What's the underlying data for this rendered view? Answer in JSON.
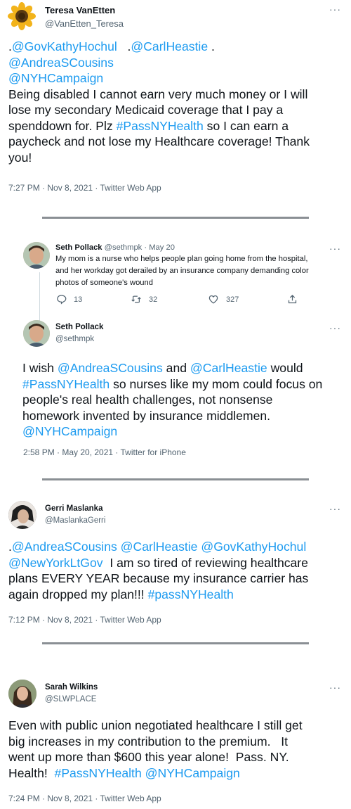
{
  "tweets": [
    {
      "name": "Teresa VanEtten",
      "handle": "@VanEtten_Teresa",
      "more": "···",
      "lines": [
        [
          {
            "t": ".",
            "l": false
          },
          {
            "t": "@GovKathyHochul",
            "l": true
          },
          {
            "t": "   .",
            "l": false
          },
          {
            "t": "@CarlHeastie",
            "l": true
          },
          {
            "t": " .",
            "l": false
          }
        ],
        [
          {
            "t": "@AndreaSCousins",
            "l": true
          }
        ],
        [
          {
            "t": "@NYHCampaign",
            "l": true
          }
        ],
        [
          {
            "t": "Being disabled I cannot earn very much money or I will",
            "l": false
          }
        ],
        [
          {
            "t": "lose my secondary Medicaid coverage that I pay a",
            "l": false
          }
        ],
        [
          {
            "t": "spenddown for. Plz ",
            "l": false
          },
          {
            "t": "#PassNYHealth",
            "l": true
          },
          {
            "t": " so I can earn a",
            "l": false
          }
        ],
        [
          {
            "t": "paycheck and not lose my Healthcare coverage! Thank",
            "l": false
          }
        ],
        [
          {
            "t": "you!",
            "l": false
          }
        ]
      ],
      "meta": "7:27 PM · Nov 8, 2021 · Twitter Web App"
    },
    {
      "quoted": {
        "name": "Seth Pollack",
        "handle": "@sethmpk",
        "date": "· May 20",
        "more": "···",
        "lines": [
          "My mom is a nurse who helps people plan going home from the hospital,",
          "and her workday got derailed by an insurance company demanding color",
          "photos of someone's wound"
        ],
        "replies": "13",
        "retweets": "32",
        "likes": "327"
      },
      "name": "Seth Pollack",
      "handle": "@sethmpk",
      "more": "···",
      "lines": [
        [
          {
            "t": "I wish ",
            "l": false
          },
          {
            "t": "@AndreaSCousins",
            "l": true
          },
          {
            "t": " and ",
            "l": false
          },
          {
            "t": "@CarlHeastie",
            "l": true
          },
          {
            "t": " would",
            "l": false
          }
        ],
        [
          {
            "t": "#PassNYHealth",
            "l": true
          },
          {
            "t": " so nurses like my mom could focus on",
            "l": false
          }
        ],
        [
          {
            "t": "people's real health challenges, not nonsense",
            "l": false
          }
        ],
        [
          {
            "t": "homework invented by insurance middlemen.",
            "l": false
          }
        ],
        [
          {
            "t": "@NYHCampaign",
            "l": true
          }
        ]
      ],
      "meta": "2:58 PM · May 20, 2021 · Twitter for iPhone"
    },
    {
      "name": "Gerri Maslanka",
      "handle": "@MaslankaGerri",
      "more": "···",
      "lines": [
        [
          {
            "t": ".",
            "l": false
          },
          {
            "t": "@AndreaSCousins",
            "l": true
          },
          {
            "t": " ",
            "l": false
          },
          {
            "t": "@CarlHeastie",
            "l": true
          },
          {
            "t": " ",
            "l": false
          },
          {
            "t": "@GovKathyHochul",
            "l": true
          }
        ],
        [
          {
            "t": "@NewYorkLtGov",
            "l": true
          },
          {
            "t": "  I am so tired of reviewing healthcare",
            "l": false
          }
        ],
        [
          {
            "t": "plans EVERY YEAR because my insurance carrier has",
            "l": false
          }
        ],
        [
          {
            "t": "again dropped my plan!!! ",
            "l": false
          },
          {
            "t": "#passNYHealth",
            "l": true
          }
        ]
      ],
      "meta": "7:12 PM · Nov 8, 2021 · Twitter Web App"
    },
    {
      "name": "Sarah Wilkins",
      "handle": "@SLWPLACE",
      "more": "···",
      "lines": [
        [
          {
            "t": "Even with public union negotiated healthcare I still get",
            "l": false
          }
        ],
        [
          {
            "t": "big increases in my contribution to the premium.   It",
            "l": false
          }
        ],
        [
          {
            "t": "went up more than $600 this year alone!  Pass. NY.",
            "l": false
          }
        ],
        [
          {
            "t": "Health!  ",
            "l": false
          },
          {
            "t": "#PassNYHealth",
            "l": true
          },
          {
            "t": " ",
            "l": false
          },
          {
            "t": "@NYHCampaign",
            "l": true
          }
        ]
      ],
      "meta": "7:24 PM · Nov 8, 2021 · Twitter Web App"
    }
  ],
  "colors": {
    "text": "#0f1419",
    "secondary": "#536471",
    "link": "#1d9bf0",
    "separator": "#8a8f94"
  },
  "icons": [
    "sunflower-avatar-icon",
    "profile-avatar-icon",
    "reply-icon",
    "retweet-icon",
    "like-icon",
    "share-icon",
    "more-icon"
  ]
}
